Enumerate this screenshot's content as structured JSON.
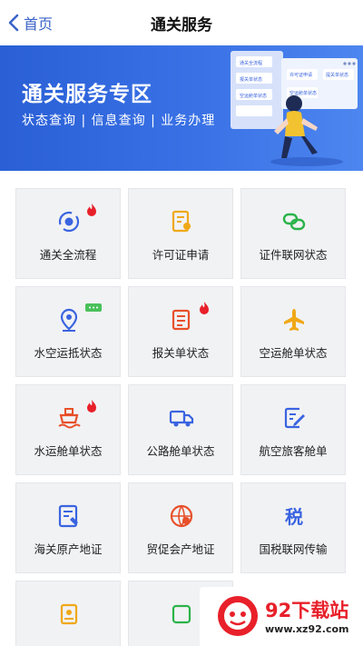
{
  "nav": {
    "back_label": "首页",
    "title": "通关服务"
  },
  "banner": {
    "title": "通关服务专区",
    "subtitle": "状态查询 | 信息查询 | 业务办理",
    "card_labels": [
      "通关全流程",
      "报关单状态",
      "空运舱单状态",
      "许可证申请",
      "提关单状态",
      "空运舱单状态"
    ]
  },
  "services": [
    {
      "label": "通关全流程",
      "icon": "cycle-icon",
      "color": "#3a64e0",
      "hot": true
    },
    {
      "label": "许可证申请",
      "icon": "license-icon",
      "color": "#f0a817",
      "hot": false
    },
    {
      "label": "证件联网状态",
      "icon": "link-icon",
      "color": "#2bb34a",
      "hot": false
    },
    {
      "label": "水空运抵状态",
      "icon": "location-icon",
      "color": "#3a64e0",
      "hot": false,
      "chat": true
    },
    {
      "label": "报关单状态",
      "icon": "document-icon",
      "color": "#e8502a",
      "hot": true
    },
    {
      "label": "空运舱单状态",
      "icon": "airplane-icon",
      "color": "#f0a817",
      "hot": false
    },
    {
      "label": "水运舱单状态",
      "icon": "ship-icon",
      "color": "#e8502a",
      "hot": true
    },
    {
      "label": "公路舱单状态",
      "icon": "truck-icon",
      "color": "#3a64e0",
      "hot": false
    },
    {
      "label": "航空旅客舱单",
      "icon": "form-edit-icon",
      "color": "#3a64e0",
      "hot": false
    },
    {
      "label": "海关原产地证",
      "icon": "certificate-icon",
      "color": "#3a64e0",
      "hot": false
    },
    {
      "label": "贸促会产地证",
      "icon": "globe-certificate-icon",
      "color": "#e8502a",
      "hot": false
    },
    {
      "label": "国税联网传输",
      "icon": "tax-icon",
      "color": "#3a64e0",
      "hot": false
    },
    {
      "label": "",
      "icon": "badge-icon",
      "color": "#f0a817",
      "hot": false
    },
    {
      "label": "",
      "icon": "partial-icon",
      "color": "#2bb34a",
      "hot": false
    }
  ],
  "watermark": {
    "title": "92下载站",
    "url": "www.xz92.com"
  }
}
